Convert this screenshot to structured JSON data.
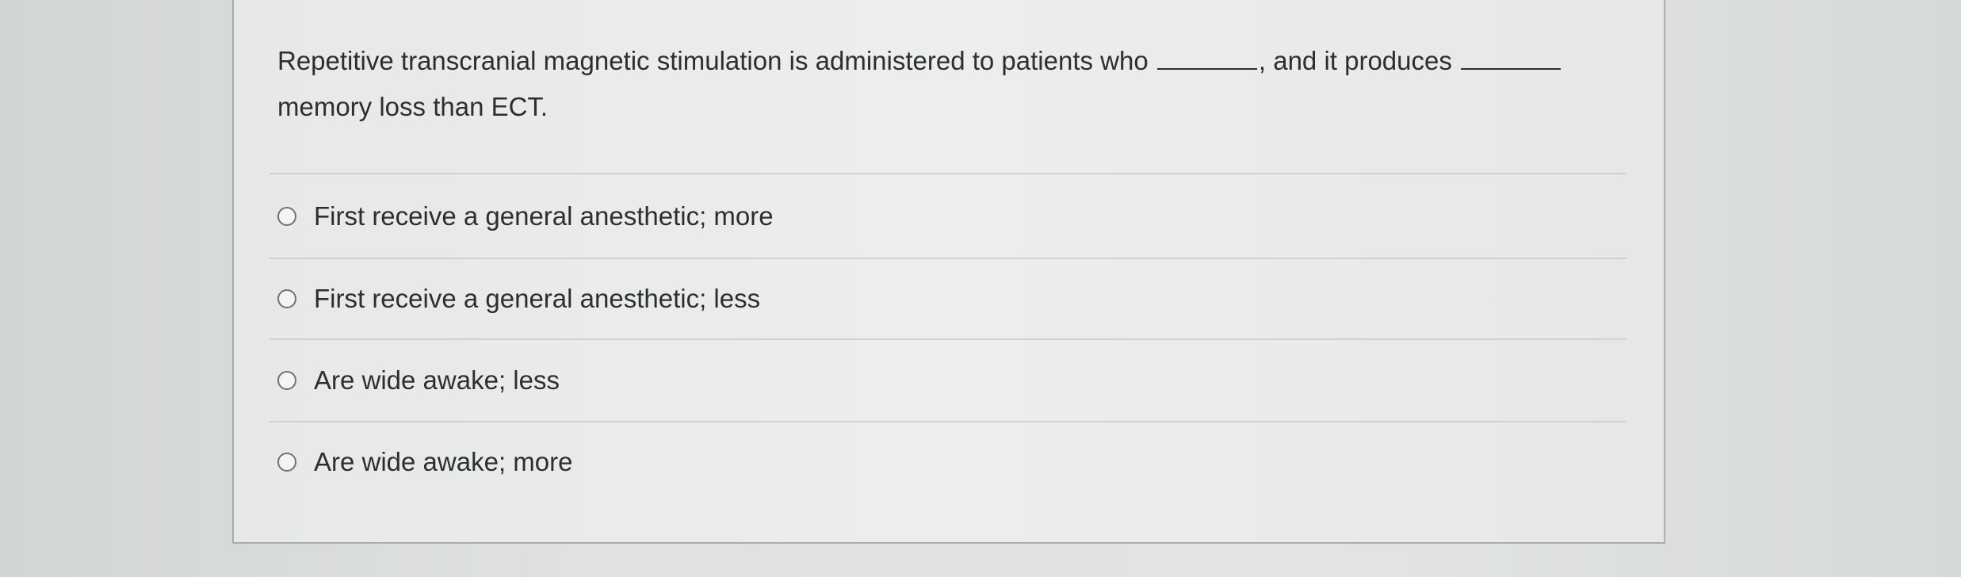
{
  "question": {
    "part1": "Repetitive transcranial magnetic stimulation is administered to patients who",
    "part2": ", and it produces",
    "part3": "memory loss than ECT."
  },
  "options": [
    {
      "label": "First receive a general anesthetic; more",
      "selected": false
    },
    {
      "label": "First receive a general anesthetic; less",
      "selected": false
    },
    {
      "label": "Are wide awake; less",
      "selected": false
    },
    {
      "label": "Are wide awake; more",
      "selected": false
    }
  ]
}
